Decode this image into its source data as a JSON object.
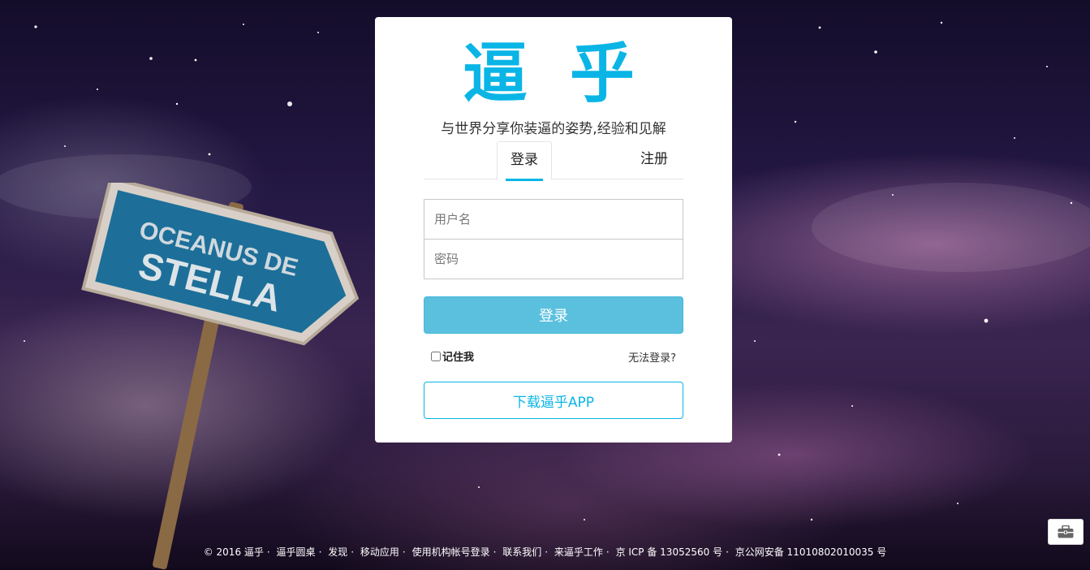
{
  "brand": {
    "logo_text": "逼 乎",
    "slogan": "与世界分享你装逼的姿势,经验和见解",
    "accent": "#0ab5e6"
  },
  "tabs": [
    {
      "label": "登录",
      "active": true
    },
    {
      "label": "注册",
      "active": false
    }
  ],
  "form": {
    "username_placeholder": "用户名",
    "password_placeholder": "密码",
    "login_button": "登录",
    "remember_label": "记住我",
    "forgot_link": "无法登录?",
    "download_button": "下载逼乎APP",
    "login_button_color": "#5bc0de"
  },
  "sign": {
    "line1": "OCEANUS DE",
    "line2": "STELLA"
  },
  "footer": {
    "items": [
      "© 2016 逼乎",
      "逼乎圆桌",
      "发现",
      "移动应用",
      "使用机构帐号登录",
      "联系我们",
      "来逼乎工作",
      "京 ICP 备 13052560 号",
      "京公网安备 11010802010035 号"
    ]
  },
  "corner": {
    "icon": "briefcase-icon"
  }
}
